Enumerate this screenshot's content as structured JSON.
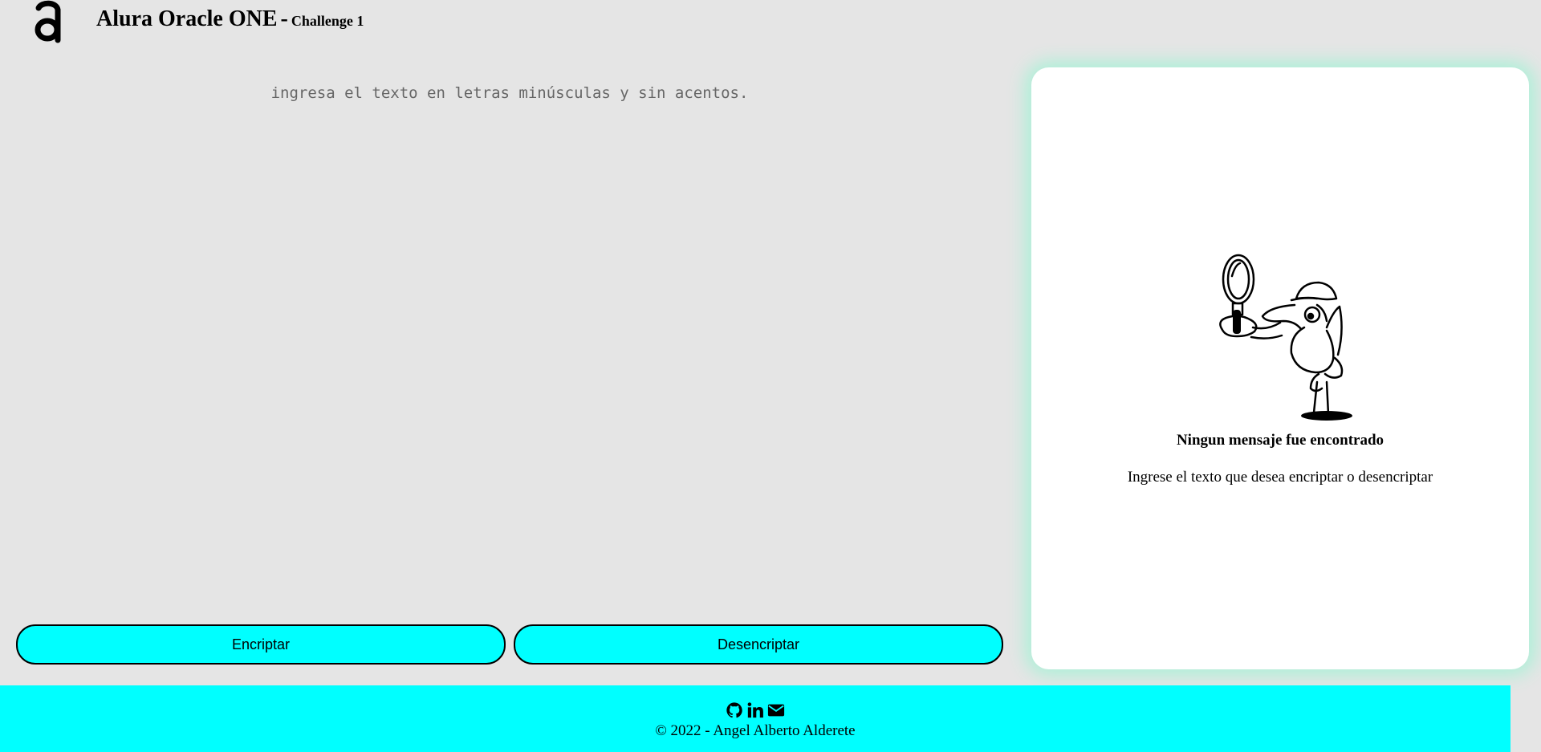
{
  "header": {
    "title": "Alura Oracle ONE",
    "separator": "-",
    "subtitle": "Challenge 1"
  },
  "input": {
    "placeholder": "ingresa el texto en letras minúsculas y sin acentos.",
    "value": ""
  },
  "buttons": {
    "encrypt": "Encriptar",
    "decrypt": "Desencriptar"
  },
  "result": {
    "title": "Ningun mensaje fue encontrado",
    "text": "Ingrese el texto que desea encriptar o desencriptar"
  },
  "footer": {
    "copyright": "© 2022 - Angel Alberto Alderete",
    "icons": [
      "github-icon",
      "linkedin-icon",
      "email-icon"
    ]
  },
  "colors": {
    "background": "#e5e5e5",
    "accent": "#00ffff",
    "card": "#ffffff",
    "card_glow": "#aef0d8"
  }
}
